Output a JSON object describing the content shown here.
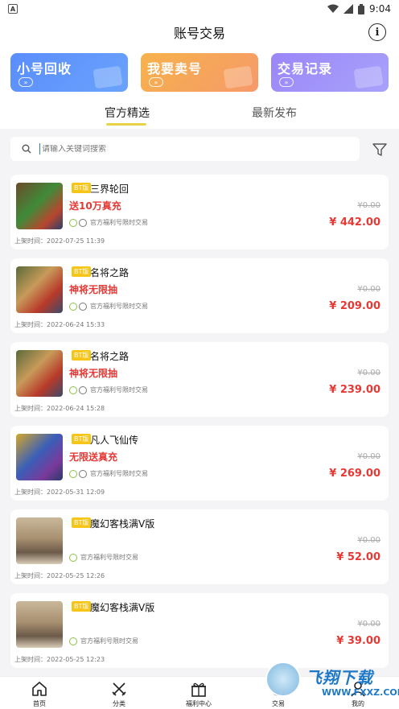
{
  "status_bar": {
    "app_badge": "A",
    "time": "9:04"
  },
  "header": {
    "title": "账号交易"
  },
  "actions": [
    {
      "label": "小号回收",
      "arrow": "»"
    },
    {
      "label": "我要卖号",
      "arrow": "»"
    },
    {
      "label": "交易记录",
      "arrow": "»"
    }
  ],
  "tabs": [
    {
      "label": "官方精选",
      "active": true
    },
    {
      "label": "最新发布",
      "active": false
    }
  ],
  "search": {
    "placeholder": "请输入关键词搜索"
  },
  "items": [
    {
      "badge": "BT版",
      "name": "三界轮回",
      "promo": "送10万真充",
      "tag": "官方福利号限时交易",
      "old_price": "¥0.00",
      "price": "¥ 442.00",
      "listed": "上架时间：2022-07-25 11:39"
    },
    {
      "badge": "BT版",
      "name": "名将之路",
      "promo": "神将无限抽",
      "tag": "官方福利号限时交易",
      "old_price": "¥0.00",
      "price": "¥ 209.00",
      "listed": "上架时间：2022-06-24 15:33"
    },
    {
      "badge": "BT版",
      "name": "名将之路",
      "promo": "神将无限抽",
      "tag": "官方福利号限时交易",
      "old_price": "¥0.00",
      "price": "¥ 239.00",
      "listed": "上架时间：2022-06-24 15:28"
    },
    {
      "badge": "BT版",
      "name": "凡人飞仙传",
      "promo": "无限送真充",
      "tag": "官方福利号限时交易",
      "old_price": "¥0.00",
      "price": "¥ 269.00",
      "listed": "上架时间：2022-05-31 12:09"
    },
    {
      "badge": "BT版",
      "name": "魔幻客栈满V版",
      "promo": "",
      "tag": "官方福利号限时交易",
      "old_price": "¥0.00",
      "price": "¥ 52.00",
      "listed": "上架时间：2022-05-25 12:26"
    },
    {
      "badge": "BT版",
      "name": "魔幻客栈满V版",
      "promo": "",
      "tag": "官方福利号限时交易",
      "old_price": "¥0.00",
      "price": "¥ 39.00",
      "listed": "上架时间：2022-05-25 12:23"
    }
  ],
  "nav": [
    {
      "label": "首页",
      "icon": "home-icon"
    },
    {
      "label": "分类",
      "icon": "swords-icon"
    },
    {
      "label": "福利中心",
      "icon": "gift-icon"
    },
    {
      "label": "交易",
      "icon": "trade-icon"
    },
    {
      "label": "我的",
      "icon": "user-icon"
    }
  ],
  "watermark": {
    "title": "飞翔下载",
    "url": "WWW.FXXZ.COM"
  },
  "colors": {
    "price_red": "#e53935",
    "badge_yellow": "#f5c518",
    "tab_underline": "#e8d44a",
    "card_blue": "#5a8dfd",
    "card_orange": "#f7b24b",
    "card_purple": "#9b86f8"
  }
}
